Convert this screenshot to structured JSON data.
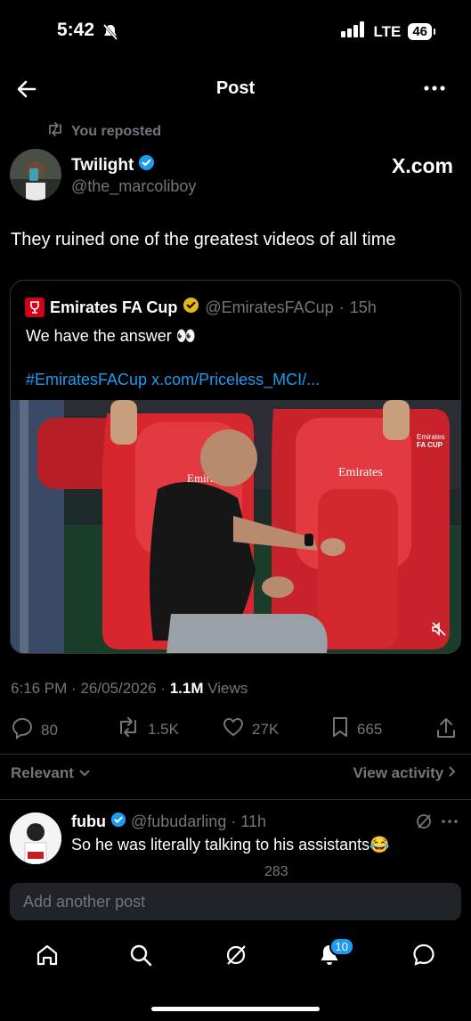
{
  "status": {
    "time": "5:42",
    "network": "LTE",
    "battery": "46"
  },
  "nav": {
    "title": "Post"
  },
  "repost": {
    "label": "You reposted"
  },
  "author": {
    "name": "Twilight",
    "handle": "@the_marcoliboy",
    "source": "X.com"
  },
  "tweet": {
    "text": "They ruined one of the greatest videos of all time"
  },
  "quote": {
    "name": "Emirates FA Cup",
    "handle": "@EmiratesFACup",
    "dot": "·",
    "time": "15h",
    "text": "We have the answer 👀",
    "hashtag": "#EmiratesFACup",
    "link": "x.com/Priceless_MCI/..."
  },
  "media": {
    "sponsor": "Emirates",
    "badge": "Emirates\nFA CUP"
  },
  "meta": {
    "time": "6:16 PM",
    "dot": "·",
    "date": "26/05/2026",
    "dot2": "·",
    "views_count": "1.1M",
    "views_label": "Views"
  },
  "actions": {
    "replies": "80",
    "reposts": "1.5K",
    "likes": "27K",
    "bookmarks": "665"
  },
  "filters": {
    "relevant": "Relevant",
    "view_activity": "View activity"
  },
  "reply": {
    "name": "fubu",
    "handle": "@fubudarling",
    "dot": "·",
    "time": "11h",
    "text": "So he was literally talking to his assistants😂",
    "likes_partial": "283"
  },
  "compose": {
    "placeholder": "Add another post"
  },
  "tabbar": {
    "notifications_badge": "10"
  },
  "colors": {
    "accent": "#1d9bf0",
    "background": "#000000",
    "muted": "#71767b",
    "seat_red": "#d7262e"
  }
}
